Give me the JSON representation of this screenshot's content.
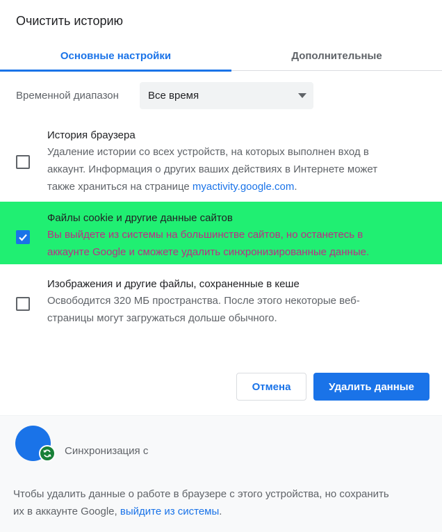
{
  "dialog": {
    "title": "Очистить историю"
  },
  "tabs": [
    {
      "label": "Основные настройки",
      "active": true
    },
    {
      "label": "Дополнительные",
      "active": false
    }
  ],
  "time_range": {
    "label": "Временной диапазон",
    "selected": "Все время"
  },
  "options": [
    {
      "title": "История браузера",
      "desc_line1": "Удаление истории со всех устройств, на которых выполнен вход в",
      "desc_line2": "аккаунт. Информация о других ваших действиях в Интернете может",
      "desc_line3_prefix": "также храниться на странице ",
      "link": "myactivity.google.com",
      "desc_line3_suffix": ".",
      "checked": false
    },
    {
      "title": "Файлы cookie и другие данные сайтов",
      "desc_line1": "Вы выйдете из системы на большинстве сайтов, но останетесь в",
      "desc_line2": "аккаунте Google и сможете удалить синхронизированные данные.",
      "checked": true
    },
    {
      "title": "Изображения и другие файлы, сохраненные в кеше",
      "desc_line1": "Освободится 320 МБ пространства. После этого некоторые веб-",
      "desc_line2": "страницы могут загружаться дольше обычного.",
      "checked": false
    }
  ],
  "buttons": {
    "cancel": "Отмена",
    "delete": "Удалить данные"
  },
  "footer": {
    "sync_label": "Синхронизация с",
    "note_line1": "Чтобы удалить данные о работе в браузере с этого устройства, но сохранить",
    "note_line2_prefix": "их в аккаунте Google, ",
    "note_link": "выйдите из системы",
    "note_line2_suffix": "."
  },
  "colors": {
    "accent": "#1a73e8",
    "highlight_row": "#20ef72",
    "highlight_text": "#bb2d86",
    "sync_badge": "#188038"
  },
  "icons": {
    "dropdown": "caret-down-icon",
    "check": "check-icon",
    "sync": "sync-icon",
    "avatar": "avatar"
  }
}
